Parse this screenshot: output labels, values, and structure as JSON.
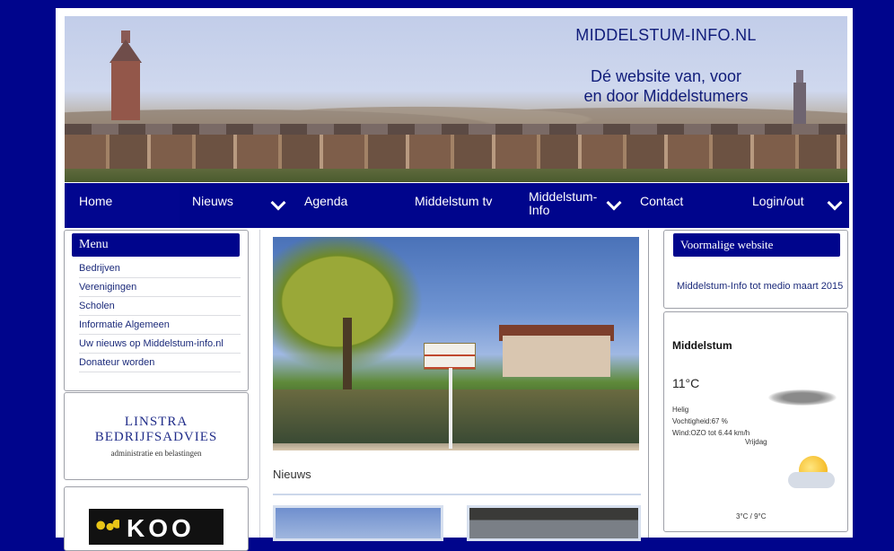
{
  "banner": {
    "site_name": "MIDDELSTUM-INFO.NL",
    "tagline_line1": "Dé website van, voor",
    "tagline_line2": "en door Middelstumers"
  },
  "nav": {
    "items": [
      {
        "label": "Home",
        "has_dropdown": false
      },
      {
        "label": "Nieuws",
        "has_dropdown": true
      },
      {
        "label": "Agenda",
        "has_dropdown": false
      },
      {
        "label": "Middelstum tv",
        "has_dropdown": false
      },
      {
        "label": "Middelstum-\nInfo",
        "has_dropdown": true
      },
      {
        "label": "Contact",
        "has_dropdown": false
      },
      {
        "label": "Login/out",
        "has_dropdown": true
      }
    ]
  },
  "menu": {
    "title": "Menu",
    "items": [
      "Bedrijven",
      "Verenigingen",
      "Scholen",
      "Informatie Algemeen",
      "Uw nieuws op Middelstum-info.nl",
      "Donateur worden"
    ]
  },
  "ads": {
    "linstra_line1": "LINSTRA",
    "linstra_line2": "BEDRIJFSADVIES",
    "linstra_sub": "administratie en belastingen",
    "koo": "KOO"
  },
  "center": {
    "section_title": "Nieuws"
  },
  "vorige": {
    "title": "Voormalige website",
    "link": "Middelstum-Info tot medio maart 2015"
  },
  "weather": {
    "city": "Middelstum",
    "temp": "11°C",
    "condition": "Helig",
    "humidity": "Vochtigheid:67 %",
    "wind": "Wind:OZO tot 6.44 km/h",
    "day": "Vrijdag",
    "range": "3°C  /  9°C"
  },
  "colors": {
    "background": "#00058c",
    "nav": "#00058c",
    "link": "#1b2a7a"
  }
}
